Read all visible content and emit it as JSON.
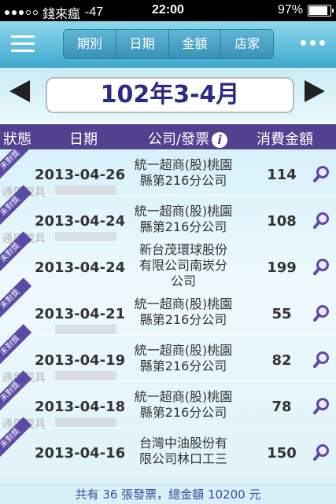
{
  "status_bar": {
    "carrier": "錢來瘋",
    "signal": "-47",
    "time": "22:00",
    "battery": "97%",
    "battery_level": 0.97
  },
  "nav": {
    "tabs": [
      "期別",
      "日期",
      "金額",
      "店家"
    ]
  },
  "period": {
    "label": "102年3-4月"
  },
  "table_header": {
    "status": "狀態",
    "date": "日期",
    "company": "公司/發票",
    "amount": "消費金額"
  },
  "rows": [
    {
      "ribbon": "未對獎",
      "carrier": "通用載具",
      "date": "2013-04-26",
      "store_line1": "統一超商(股)桃園",
      "store_line2": "縣第216分公司",
      "store_line3": "",
      "amount": "114"
    },
    {
      "ribbon": "未對獎",
      "carrier": "通用載具",
      "date": "2013-04-24",
      "store_line1": "統一超商(股)桃園",
      "store_line2": "縣第216分公司",
      "store_line3": "",
      "amount": "108"
    },
    {
      "ribbon": "未對獎",
      "carrier": "",
      "date": "2013-04-24",
      "store_line1": "新台茂環球股份",
      "store_line2": "有限公司南崁分",
      "store_line3": "公司",
      "amount": "199"
    },
    {
      "ribbon": "未對獎",
      "carrier": "",
      "date": "2013-04-21",
      "store_line1": "統一超商(股)桃園",
      "store_line2": "縣第216分公司",
      "store_line3": "",
      "amount": "55"
    },
    {
      "ribbon": "未對獎",
      "carrier": "通用載具",
      "date": "2013-04-19",
      "store_line1": "統一超商(股)桃園",
      "store_line2": "縣第216分公司",
      "store_line3": "",
      "amount": "82"
    },
    {
      "ribbon": "未對獎",
      "carrier": "通用載具",
      "date": "2013-04-18",
      "store_line1": "統一超商(股)桃園",
      "store_line2": "縣第216分公司",
      "store_line3": "",
      "amount": "78"
    },
    {
      "ribbon": "未對獎",
      "carrier": "",
      "date": "2013-04-16",
      "store_line1": "台灣中油股份有",
      "store_line2": "限公司林口工三",
      "store_line3": "",
      "amount": "150"
    }
  ],
  "footer": {
    "summary": "共有 36 張發票，總金額 10200 元"
  },
  "icons": {
    "menu": "hamburger-icon",
    "more": "more-dots-icon",
    "row_action": "search-icon",
    "header_info": "info-icon"
  },
  "colors": {
    "header_bg": "#51418f",
    "period_text": "#2c2a86",
    "nav_bg": "#3fa9cf",
    "ribbon": "#5b4aa6"
  }
}
